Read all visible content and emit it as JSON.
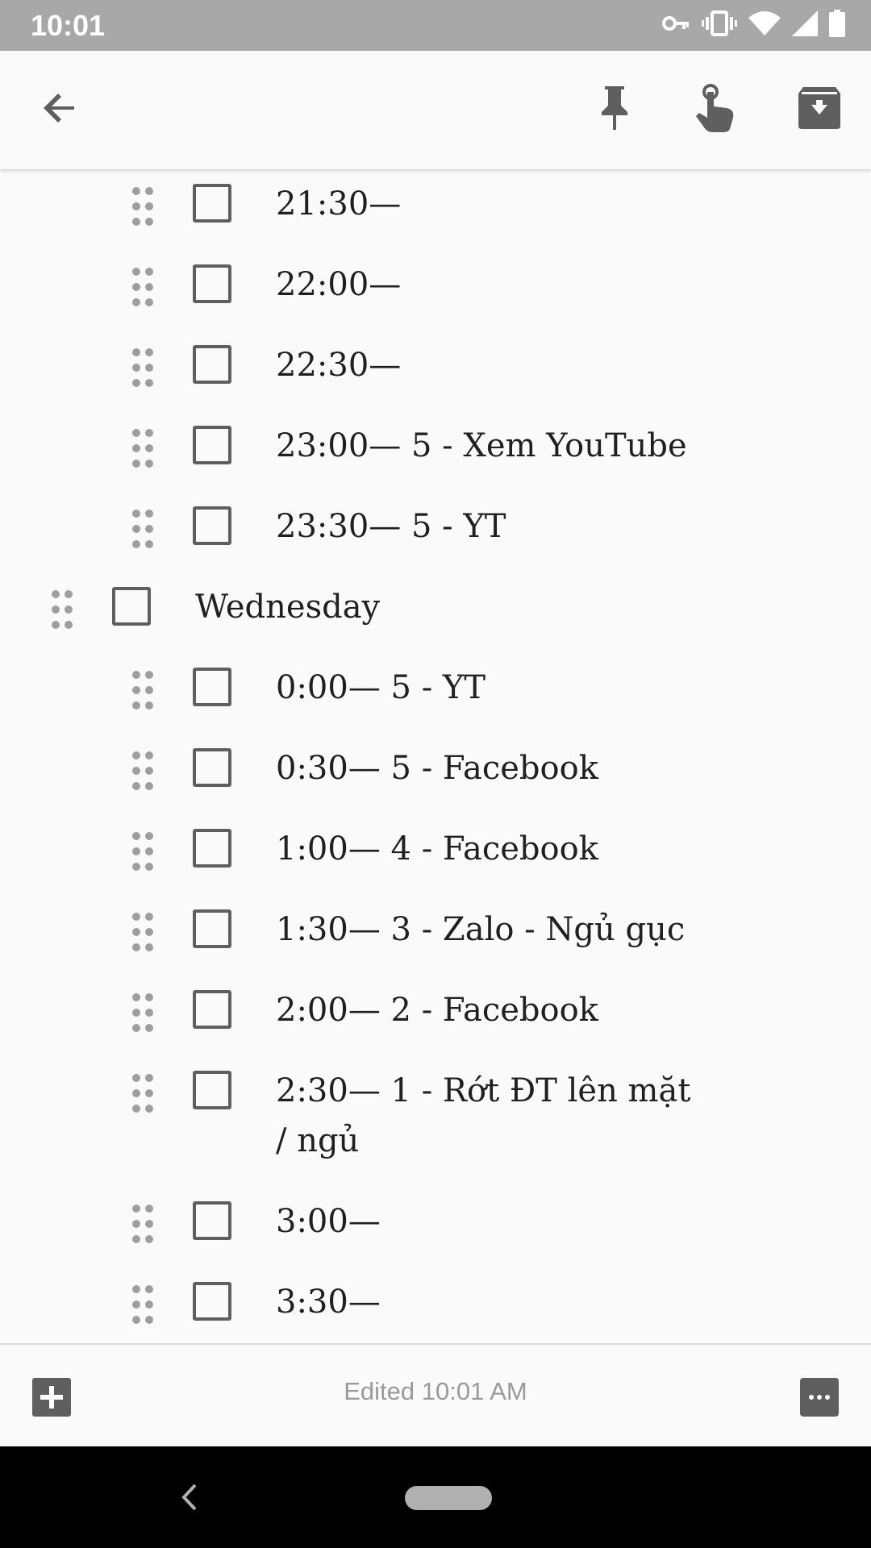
{
  "status_bar": {
    "time": "10:01",
    "icons": [
      "vpn-key-icon",
      "vibrate-icon",
      "wifi-icon",
      "cell-signal-icon",
      "battery-icon"
    ]
  },
  "toolbar": {
    "back_icon": "arrow-back-icon",
    "pin_icon": "pin-icon",
    "reminder_icon": "reminder-icon",
    "archive_icon": "archive-icon"
  },
  "checklist": {
    "items": [
      {
        "text": "21:30—",
        "checked": false,
        "indent": 1
      },
      {
        "text": "22:00—",
        "checked": false,
        "indent": 1
      },
      {
        "text": "22:30—",
        "checked": false,
        "indent": 1
      },
      {
        "text": "23:00— 5 - Xem YouTube",
        "checked": false,
        "indent": 1
      },
      {
        "text": "23:30— 5 - YT",
        "checked": false,
        "indent": 1
      },
      {
        "text": "Wednesday",
        "checked": false,
        "indent": 0
      },
      {
        "text": "0:00— 5 - YT",
        "checked": false,
        "indent": 1
      },
      {
        "text": "0:30— 5 - Facebook",
        "checked": false,
        "indent": 1
      },
      {
        "text": "1:00— 4 - Facebook",
        "checked": false,
        "indent": 1
      },
      {
        "text": "1:30— 3 - Zalo - Ngủ gục",
        "checked": false,
        "indent": 1
      },
      {
        "text": "2:00— 2 - Facebook",
        "checked": false,
        "indent": 1
      },
      {
        "text": "2:30— 1 - Rớt ĐT lên mặt / ngủ",
        "checked": false,
        "indent": 1
      },
      {
        "text": "3:00—",
        "checked": false,
        "indent": 1
      },
      {
        "text": "3:30—",
        "checked": false,
        "indent": 1
      }
    ]
  },
  "bottom_bar": {
    "edited_text": "Edited 10:01 AM",
    "add_icon": "add-box-icon",
    "more_icon": "more-horizontal-icon"
  },
  "nav_bar": {
    "back_icon": "nav-back-icon",
    "home_icon": "home-pill-icon"
  },
  "colors": {
    "status_bar": "#a8a8a8",
    "background": "#fafafa",
    "icon": "#5f5f5f",
    "text": "#202020",
    "muted_text": "#9a9a9a"
  }
}
